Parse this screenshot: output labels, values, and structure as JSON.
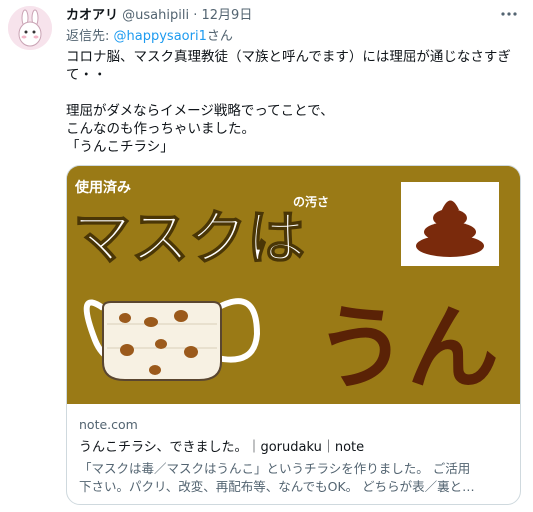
{
  "tweet": {
    "author_name": "カオアリ",
    "handle": "@usahipili",
    "separator": "·",
    "date": "12月9日",
    "more_icon": "ellipsis-icon",
    "reply_prefix": "返信先: ",
    "reply_to": "@happysaori1",
    "reply_suffix": "さん",
    "lines": [
      "コロナ脳、マスク真理教徒（マ族と呼んでます）には理屈が通じなさすぎ",
      "て・・",
      "",
      "理屈がダメならイメージ戦略でってことで、",
      "こんなのも作っちゃいました。",
      "「うんこチラシ」"
    ]
  },
  "card": {
    "image": {
      "corner_text": "使用済み",
      "main_text": "マスクは",
      "small_text": "の汚さ",
      "big_text": "うん",
      "background": "#9a7a16",
      "poop_color": "#7a2a0c"
    },
    "domain": "note.com",
    "title": "うんこチラシ、できました。｜gorudaku｜note",
    "desc_lines": [
      "「マスクは毒／マスクはうんこ」というチラシを作りました。 ご活用",
      "下さい。パクリ、改変、再配布等、なんでもOK。 どちらが表／裏と…"
    ]
  }
}
